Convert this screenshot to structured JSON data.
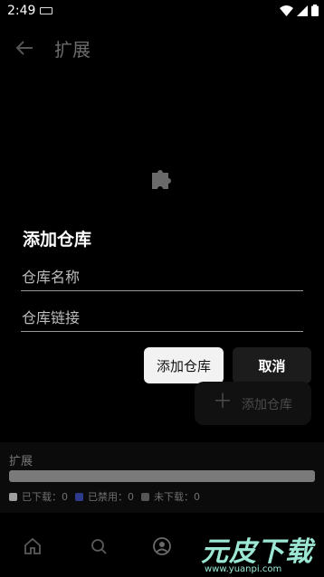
{
  "status_bar": {
    "time": "2:49"
  },
  "app_bar": {
    "title": "扩展",
    "back_icon": "arrow-left-icon"
  },
  "background": {
    "empty_icon": "puzzle-icon"
  },
  "dialog": {
    "title": "添加仓库",
    "fields": {
      "name_placeholder": "仓库名称",
      "url_placeholder": "仓库链接"
    },
    "buttons": {
      "confirm": "添加仓库",
      "cancel": "取消"
    }
  },
  "fab": {
    "icon": "plus-icon",
    "label": "添加仓库"
  },
  "stats": {
    "title": "扩展",
    "downloaded": {
      "label": "已下载",
      "count": "0",
      "color": "#9e9e9e"
    },
    "disabled": {
      "label": "已禁用",
      "count": "0",
      "color": "#2e3a8c"
    },
    "not_downloaded": {
      "label": "未下载",
      "count": "0",
      "color": "#555555"
    }
  },
  "bottom_nav": {
    "items": [
      {
        "icon": "home-icon"
      },
      {
        "icon": "search-icon"
      },
      {
        "icon": "account-icon"
      }
    ]
  },
  "watermark": {
    "text": "元皮下载",
    "url": "www.yuanpi.com"
  },
  "colors": {
    "background": "#000000",
    "dialog_text": "#ffffff",
    "primary_button": "#f2f2f2",
    "secondary_button": "#1c1c1c",
    "watermark": "#9be7d4"
  }
}
